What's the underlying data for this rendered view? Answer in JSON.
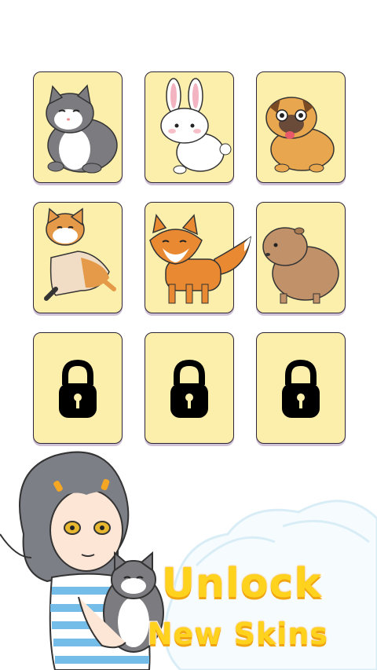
{
  "skins": [
    {
      "name": "cat",
      "locked": false
    },
    {
      "name": "rabbit",
      "locked": false
    },
    {
      "name": "pug",
      "locked": false
    },
    {
      "name": "shiba",
      "locked": false
    },
    {
      "name": "fox",
      "locked": false
    },
    {
      "name": "capybara",
      "locked": false
    },
    {
      "name": "locked",
      "locked": true
    },
    {
      "name": "locked",
      "locked": true
    },
    {
      "name": "locked",
      "locked": true
    }
  ],
  "promo": {
    "line1": "Unlock",
    "line2": "New Skins"
  },
  "colors": {
    "card": "#fcefab",
    "border": "#2c2438",
    "promo": "#ffd21e"
  }
}
